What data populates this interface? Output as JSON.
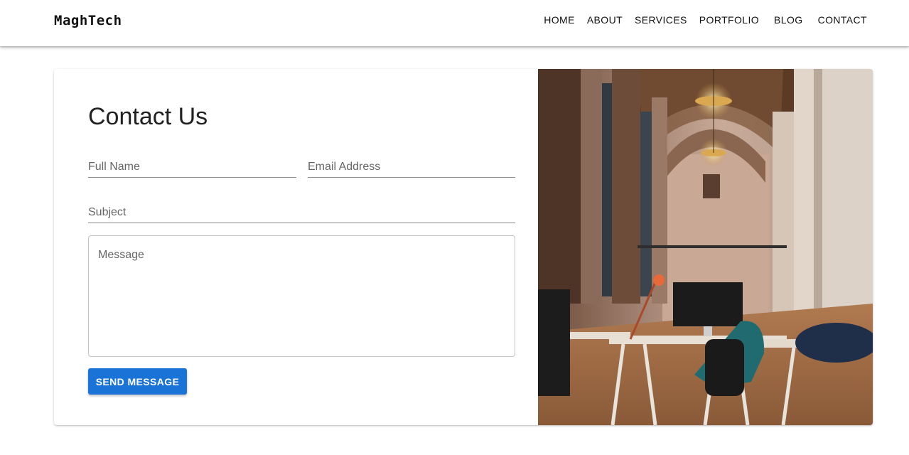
{
  "header": {
    "brand": "MaghTech",
    "nav": [
      "HOME",
      "ABOUT",
      "SERVICES",
      "PORTFOLIO",
      "BLOG",
      "CONTACT"
    ]
  },
  "contact": {
    "title": "Contact Us",
    "fields": {
      "full_name_placeholder": "Full Name",
      "email_placeholder": "Email Address",
      "subject_placeholder": "Subject",
      "message_placeholder": "Message"
    },
    "submit_label": "SEND MESSAGE"
  },
  "image": {
    "icon": "office-hall-photo"
  },
  "colors": {
    "accent": "#1a73d6"
  }
}
